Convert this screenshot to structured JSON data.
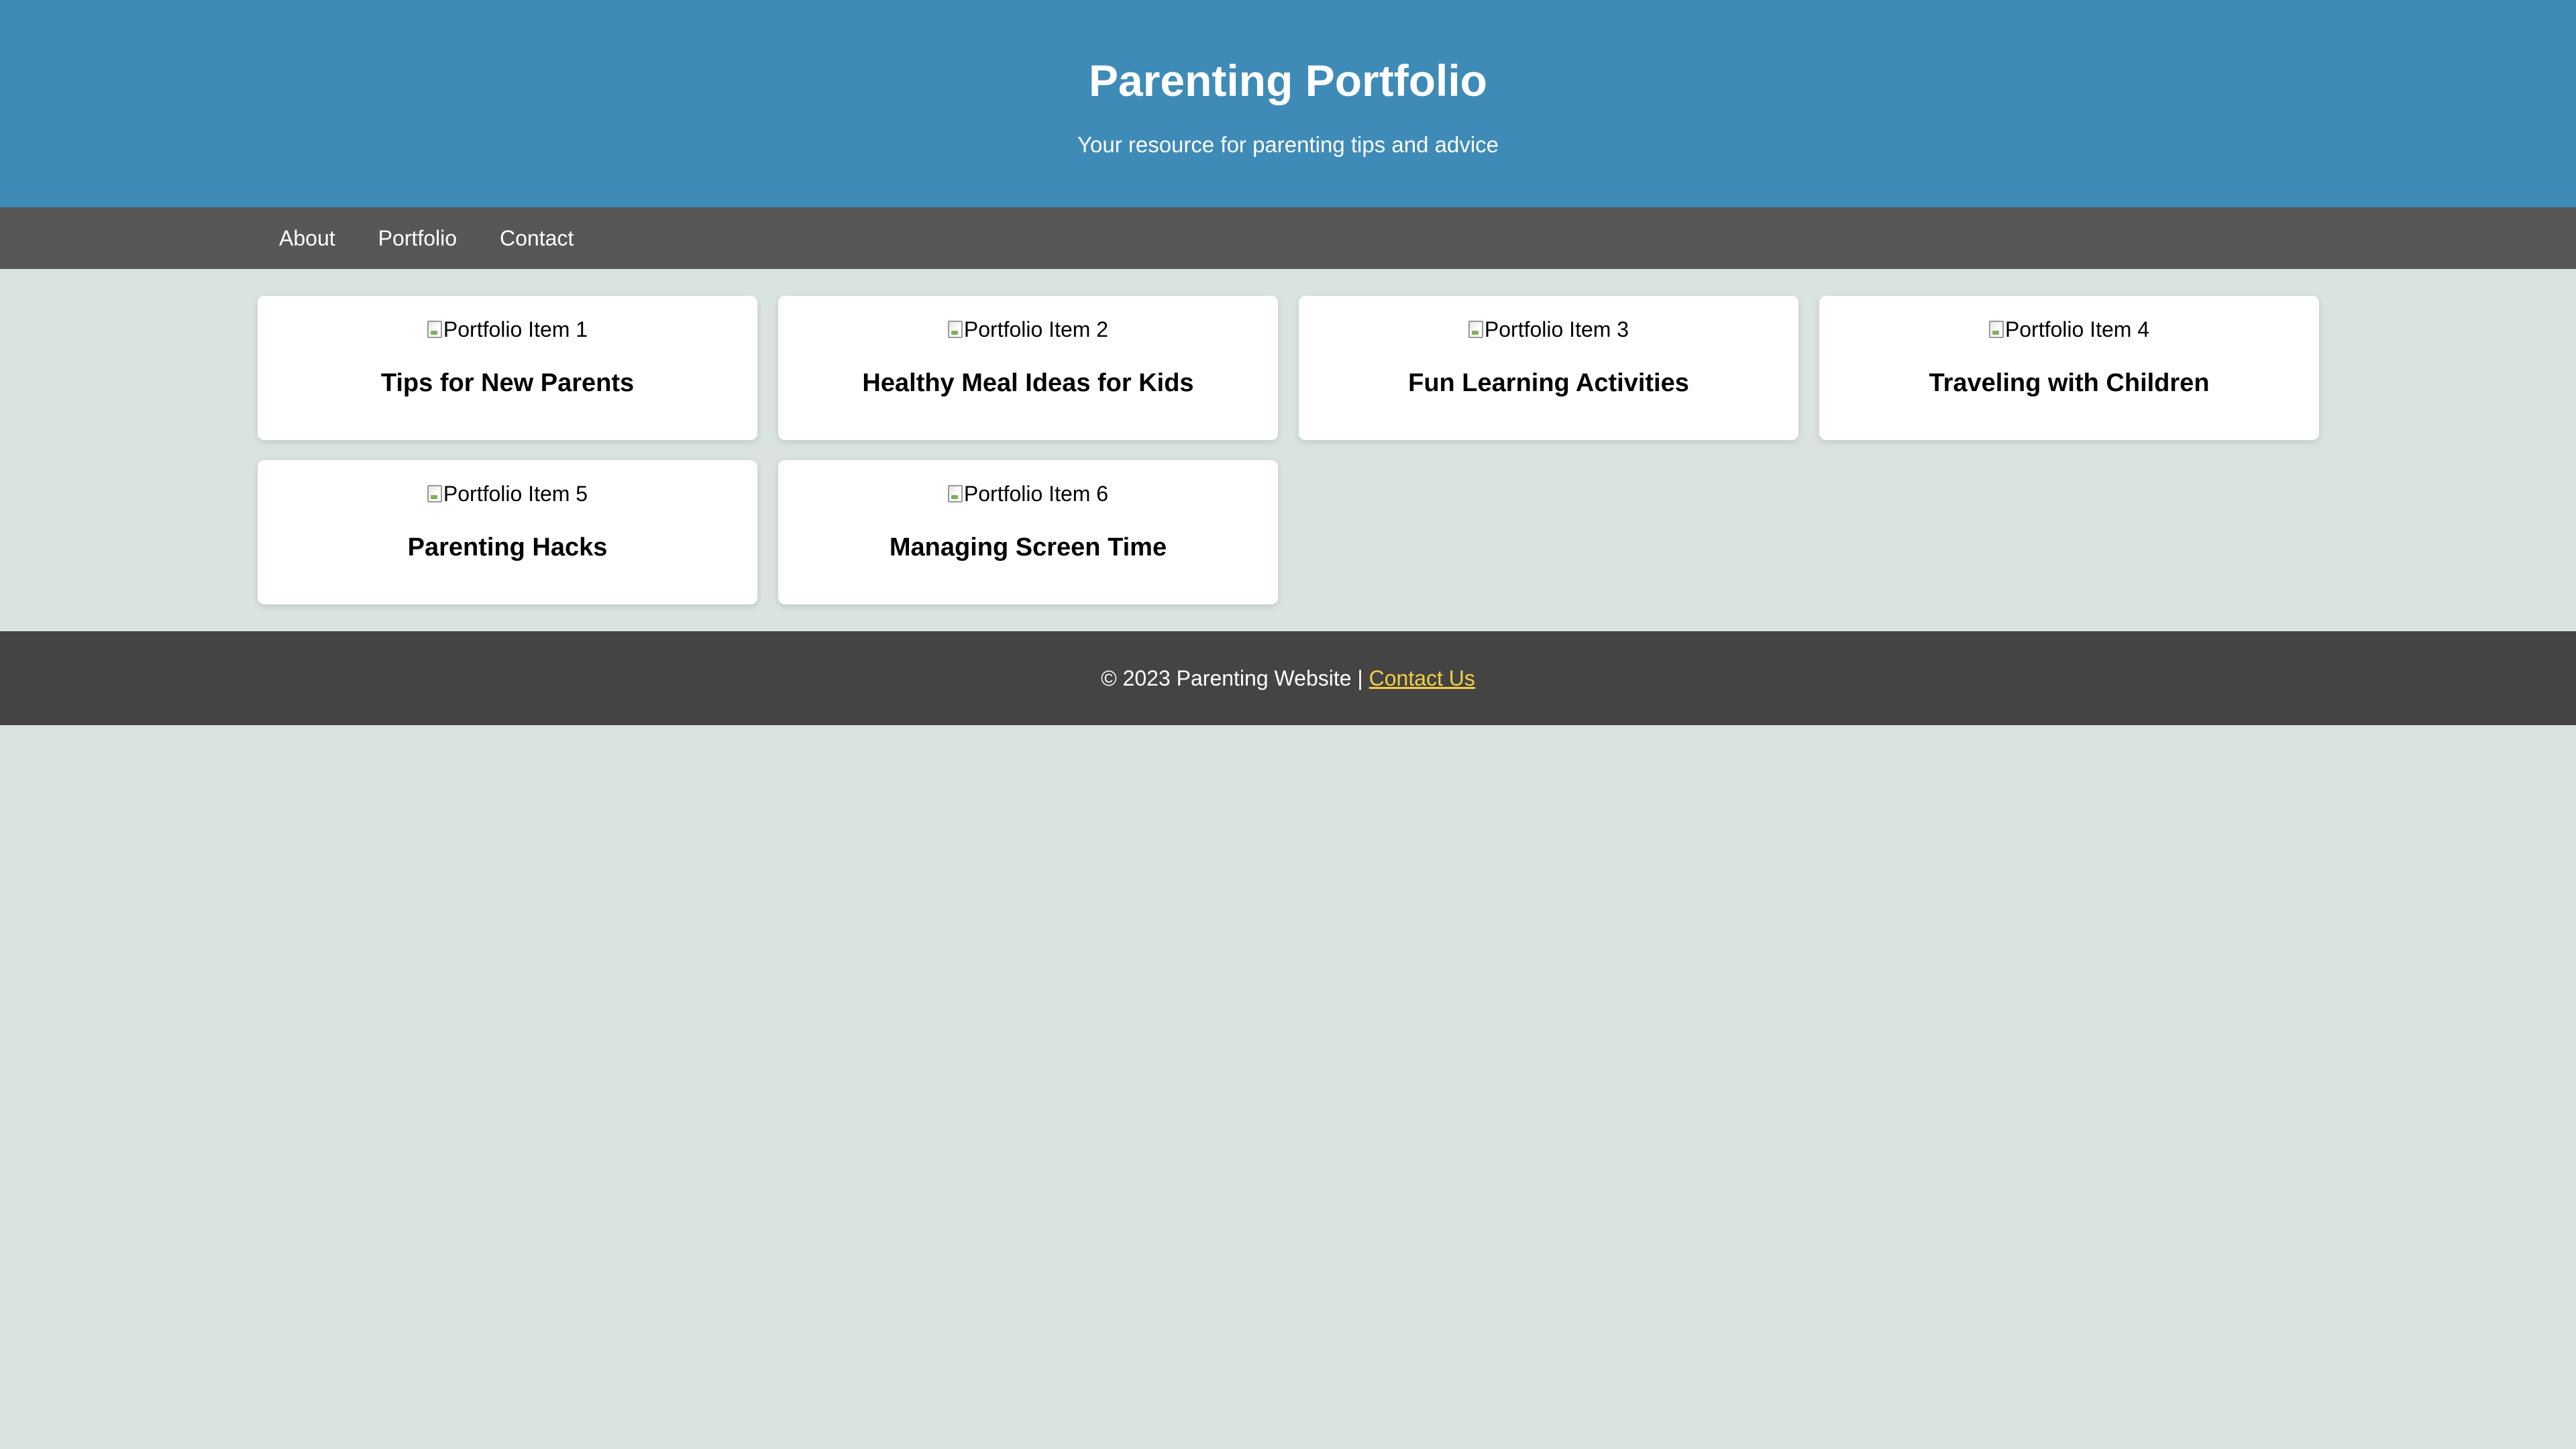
{
  "header": {
    "title": "Parenting Portfolio",
    "subtitle": "Your resource for parenting tips and advice"
  },
  "nav": {
    "items": [
      {
        "label": "About"
      },
      {
        "label": "Portfolio"
      },
      {
        "label": "Contact"
      }
    ]
  },
  "portfolio": {
    "items": [
      {
        "alt": "Portfolio Item 1",
        "title": "Tips for New Parents"
      },
      {
        "alt": "Portfolio Item 2",
        "title": "Healthy Meal Ideas for Kids"
      },
      {
        "alt": "Portfolio Item 3",
        "title": "Fun Learning Activities"
      },
      {
        "alt": "Portfolio Item 4",
        "title": "Traveling with Children"
      },
      {
        "alt": "Portfolio Item 5",
        "title": "Parenting Hacks"
      },
      {
        "alt": "Portfolio Item 6",
        "title": "Managing Screen Time"
      }
    ]
  },
  "footer": {
    "copyright": "© 2023 Parenting Website |",
    "contact_link": "Contact Us"
  },
  "colors": {
    "header_bg": "#3e8bb8",
    "nav_bg": "#575757",
    "page_bg": "#dae3e0",
    "footer_bg": "#444444",
    "link_accent": "#f3cf45"
  }
}
